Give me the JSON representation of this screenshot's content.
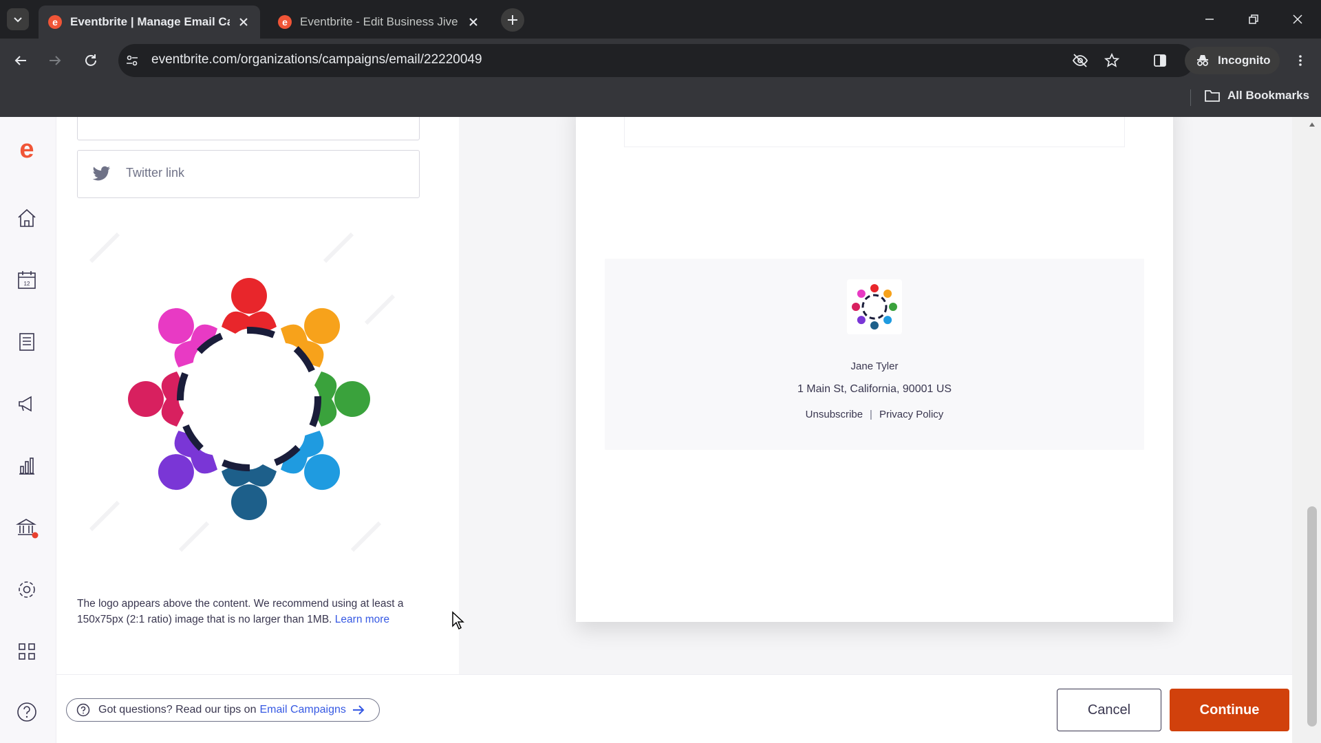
{
  "browser": {
    "tabs": [
      {
        "title": "Eventbrite | Manage Email Car",
        "active": true
      },
      {
        "title": "Eventbrite - Edit Business Jive",
        "active": false
      }
    ],
    "url": "eventbrite.com/organizations/campaigns/email/22220049",
    "incognito_label": "Incognito",
    "bookmarks_label": "All Bookmarks"
  },
  "left_nav": {
    "items": [
      "eventbrite-logo-icon",
      "home-icon",
      "calendar-icon",
      "orders-icon",
      "megaphone-icon",
      "chart-icon",
      "finance-icon",
      "settings-icon",
      "apps-icon",
      "help-icon"
    ]
  },
  "editor": {
    "twitter_label": "Twitter link",
    "logo_help_text": "The logo appears above the content. We recommend using at least a 150x75px (2:1 ratio) image that is no larger than 1MB.",
    "logo_help_link": "Learn more"
  },
  "preview": {
    "footer_name": "Jane Tyler",
    "footer_address": "1 Main St, California, 90001 US",
    "unsubscribe": "Unsubscribe",
    "privacy": "Privacy Policy"
  },
  "bottom": {
    "tips_text": "Got questions? Read our tips on",
    "tips_link": "Email Campaigns",
    "cancel": "Cancel",
    "continue": "Continue"
  },
  "colors": {
    "brand": "#d1410c",
    "link": "#3659e3",
    "text": "#39364f"
  }
}
